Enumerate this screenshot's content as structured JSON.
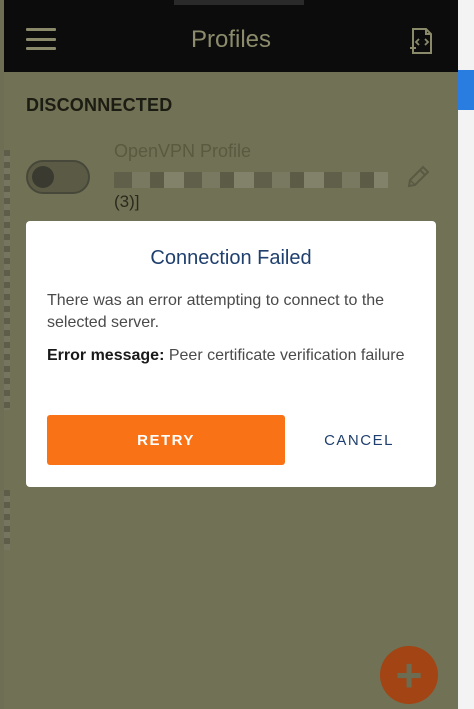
{
  "header": {
    "title": "Profiles",
    "menu_icon": "hamburger-menu-icon",
    "import_icon": "document-code-icon"
  },
  "status": {
    "label": "DISCONNECTED"
  },
  "profile": {
    "name": "OpenVPN Profile",
    "suffix": "(3)]",
    "toggle_on": false,
    "edit_icon": "pencil-icon"
  },
  "dialog": {
    "title": "Connection Failed",
    "body": "There was an error attempting to connect to the selected server.",
    "error_label": "Error message:",
    "error_text": "Peer certificate verification failure",
    "retry_label": "RETRY",
    "cancel_label": "CANCEL"
  },
  "fab": {
    "label": "+",
    "icon": "add-icon"
  },
  "colors": {
    "accent": "#f97316",
    "dialog_title": "#1f3f6e",
    "overlay": "#717155"
  }
}
